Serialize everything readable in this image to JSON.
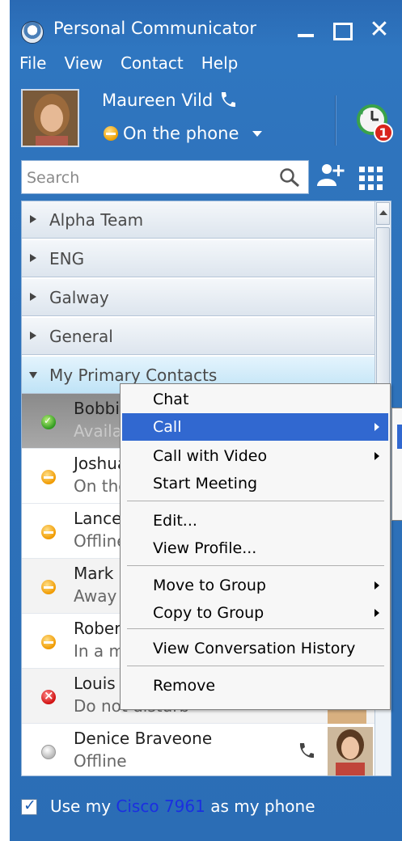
{
  "window": {
    "title": "Personal Communicator",
    "close_glyph": "✕"
  },
  "menubar": [
    "File",
    "View",
    "Contact",
    "Help"
  ],
  "profile": {
    "name": "Maureen Vild",
    "presence": "On the phone",
    "notification_count": "1"
  },
  "search": {
    "placeholder": "Search"
  },
  "groups": [
    {
      "label": "Alpha Team"
    },
    {
      "label": "ENG"
    },
    {
      "label": "Galway"
    },
    {
      "label": "General"
    },
    {
      "label": "My Primary Contacts"
    }
  ],
  "contacts": [
    {
      "name": "Bobbie",
      "status": "Availab",
      "status_type": "available"
    },
    {
      "name": "Joshua",
      "status": "On the",
      "status_type": "busy"
    },
    {
      "name": "Lance N",
      "status": "Offline",
      "status_type": "busy"
    },
    {
      "name": "Mark L",
      "status": "Away",
      "status_type": "busy"
    },
    {
      "name": "Robert",
      "status": "In a me",
      "status_type": "busy"
    },
    {
      "name": "Louis C",
      "status": "Do not disturb",
      "status_type": "dnd"
    },
    {
      "name": "Denice Braveone",
      "status": "Offline",
      "status_type": "offline"
    }
  ],
  "context_menu": {
    "items": [
      "Chat",
      "Call",
      "Call with Video",
      "Start Meeting",
      "Edit...",
      "View Profile...",
      "Move to Group",
      "Copy to Group",
      "View Conversation History",
      "Remove"
    ]
  },
  "footer": {
    "prefix": "Use my ",
    "device_link": "Cisco 7961",
    "suffix": " as my phone"
  },
  "colors": {
    "window_blue": "#2f74bd",
    "menu_highlight": "#3168d0",
    "link_blue": "#1b2fe0"
  },
  "icons": [
    "app-icon",
    "phone-icon",
    "history-alarm-icon",
    "search-icon",
    "add-contact-icon",
    "dialpad-icon"
  ]
}
